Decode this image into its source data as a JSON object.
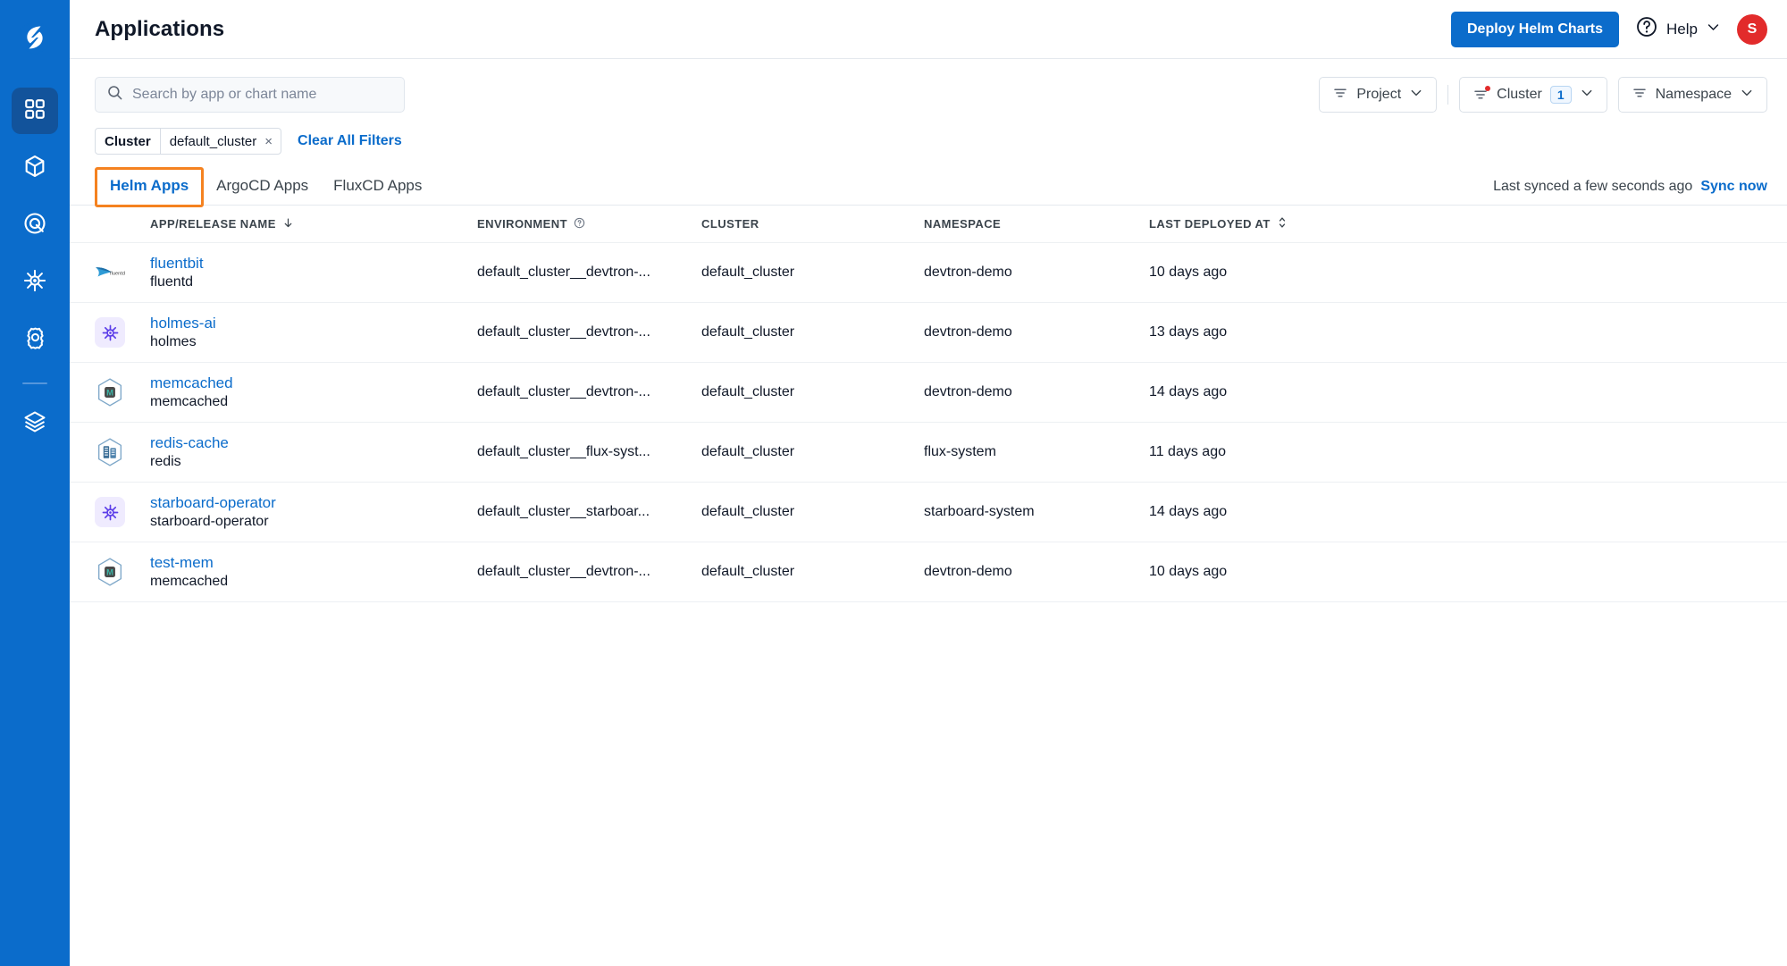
{
  "colors": {
    "brand_blue": "#0B6CCB",
    "sidebar_active": "#12539B",
    "highlight_orange": "#F58220",
    "avatar_red": "#E22B2B",
    "link_blue": "#0B6CCB",
    "purple_icon": "#5B3DE8"
  },
  "sidebar": {
    "logo_name": "devtron-logo",
    "items": [
      {
        "name": "applications",
        "icon": "grid-icon",
        "active": true
      },
      {
        "name": "chart-store",
        "icon": "cube-icon",
        "active": false
      },
      {
        "name": "resource-browser",
        "icon": "target-icon",
        "active": false
      },
      {
        "name": "jobs",
        "icon": "helm-wheel-icon",
        "active": false
      },
      {
        "name": "global-configurations",
        "icon": "gear-icon",
        "active": false
      },
      {
        "name": "stack-manager",
        "icon": "layers-icon",
        "active": false
      }
    ]
  },
  "header": {
    "title": "Applications",
    "deploy_button": "Deploy Helm Charts",
    "help_label": "Help",
    "avatar_initial": "S"
  },
  "search": {
    "placeholder": "Search by app or chart name",
    "value": ""
  },
  "filters": {
    "project": {
      "label": "Project",
      "has_dot": false,
      "count": null
    },
    "cluster": {
      "label": "Cluster",
      "has_dot": true,
      "count": "1"
    },
    "namespace": {
      "label": "Namespace",
      "has_dot": false,
      "count": null
    }
  },
  "applied_filters": {
    "chips": [
      {
        "key": "Cluster",
        "value": "default_cluster",
        "remove": "×"
      }
    ],
    "clear_all": "Clear All Filters"
  },
  "tabs": [
    {
      "label": "Helm Apps",
      "active": true,
      "highlighted": true
    },
    {
      "label": "ArgoCD Apps",
      "active": false,
      "highlighted": false
    },
    {
      "label": "FluxCD Apps",
      "active": false,
      "highlighted": false
    }
  ],
  "sync": {
    "status_text": "Last synced a few seconds ago",
    "action_label": "Sync now"
  },
  "table": {
    "columns": [
      {
        "label": "APP/RELEASE NAME",
        "sort": "down-arrow-icon"
      },
      {
        "label": "ENVIRONMENT",
        "info": "question-icon"
      },
      {
        "label": "CLUSTER",
        "sort": null
      },
      {
        "label": "NAMESPACE",
        "sort": null
      },
      {
        "label": "LAST DEPLOYED AT",
        "sort": "sort-icon"
      }
    ],
    "rows": [
      {
        "icon": "fluentd-logo-icon",
        "app_name": "fluentbit",
        "chart_name": "fluentd",
        "environment": "default_cluster__devtron-...",
        "cluster": "default_cluster",
        "namespace": "devtron-demo",
        "last_deployed_at": "10 days ago"
      },
      {
        "icon": "purple-gear-icon",
        "app_name": "holmes-ai",
        "chart_name": "holmes",
        "environment": "default_cluster__devtron-...",
        "cluster": "default_cluster",
        "namespace": "devtron-demo",
        "last_deployed_at": "13 days ago"
      },
      {
        "icon": "memcached-hex-icon",
        "app_name": "memcached",
        "chart_name": "memcached",
        "environment": "default_cluster__devtron-...",
        "cluster": "default_cluster",
        "namespace": "devtron-demo",
        "last_deployed_at": "14 days ago"
      },
      {
        "icon": "redis-hex-icon",
        "app_name": "redis-cache",
        "chart_name": "redis",
        "environment": "default_cluster__flux-syst...",
        "cluster": "default_cluster",
        "namespace": "flux-system",
        "last_deployed_at": "11 days ago"
      },
      {
        "icon": "purple-gear-icon",
        "app_name": "starboard-operator",
        "chart_name": "starboard-operator",
        "environment": "default_cluster__starboar...",
        "cluster": "default_cluster",
        "namespace": "starboard-system",
        "last_deployed_at": "14 days ago"
      },
      {
        "icon": "memcached-hex-icon",
        "app_name": "test-mem",
        "chart_name": "memcached",
        "environment": "default_cluster__devtron-...",
        "cluster": "default_cluster",
        "namespace": "devtron-demo",
        "last_deployed_at": "10 days ago"
      }
    ]
  }
}
